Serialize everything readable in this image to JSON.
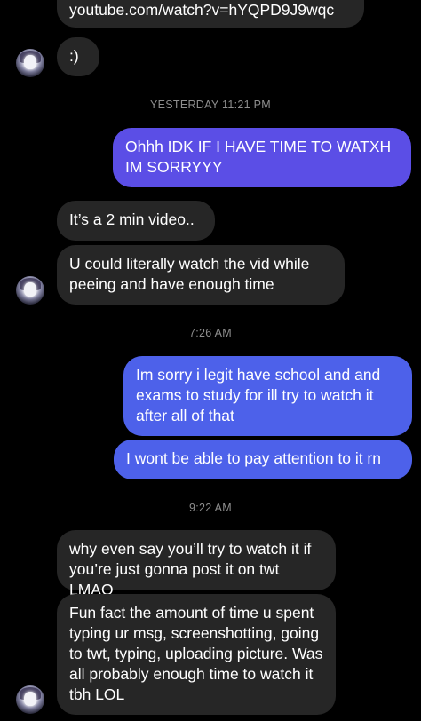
{
  "messages": {
    "link": "youtube.com/watch?v=hYQPD9J9wqc",
    "smile": ":)",
    "ts1": "YESTERDAY 11:21 PM",
    "out1": "Ohhh IDK IF I HAVE TIME TO WATXH\nIM SORRYYY",
    "in1": "It’s a 2 min video..",
    "in2": "U could literally watch the vid while\npeeing and have enough time",
    "ts2": "7:26 AM",
    "out2": "Im sorry i legit have school and and\nexams to study for ill try to watch it\nafter all of that",
    "out3": "I wont be able to pay attention to it rn",
    "ts3": "9:22 AM",
    "in3": "why even say you’ll try to watch it if\nyou’re just gonna post it on twt LMAO",
    "in4": "Fun fact the amount of time u spent\ntyping ur msg, screenshotting, going\nto twt, typing, uploading picture. Was\nall probably enough time to watch it\ntbh LOL"
  },
  "colors": {
    "incoming_bubble": "#262626",
    "outgoing_bubble_purple": "#5b4ee6",
    "outgoing_bubble_blue": "#4d61ea",
    "timestamp": "#8e8e8e"
  },
  "icons": {
    "avatar": "contact-avatar"
  }
}
